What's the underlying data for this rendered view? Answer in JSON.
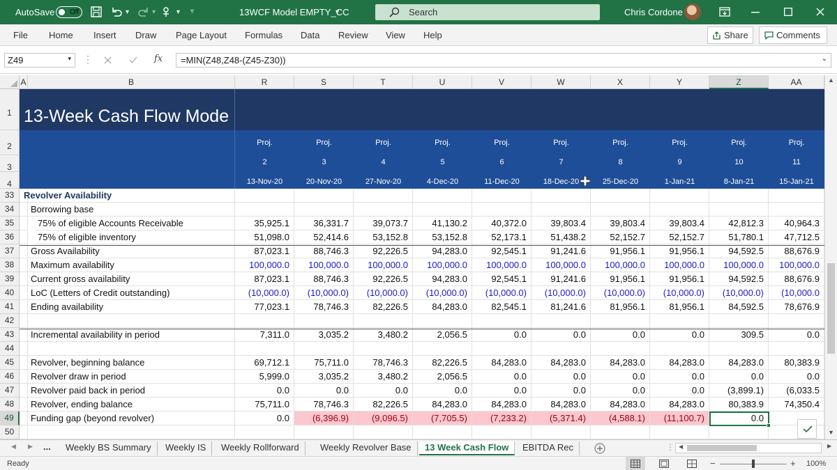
{
  "titlebar": {
    "autosave_label": "AutoSave",
    "autosave_state": "Off",
    "filename": "13WCF Model EMPTY_CC",
    "search_placeholder": "Search",
    "user_name": "Chris Cordone"
  },
  "menu": {
    "items": [
      "File",
      "Home",
      "Insert",
      "Draw",
      "Page Layout",
      "Formulas",
      "Data",
      "Review",
      "View",
      "Help"
    ],
    "share": "Share",
    "comments": "Comments"
  },
  "formula_bar": {
    "name_box": "Z49",
    "fx": "fx",
    "formula": "=MIN(Z48,Z48-(Z45-Z30))"
  },
  "columns": {
    "letters": [
      "A",
      "B",
      "R",
      "S",
      "T",
      "U",
      "V",
      "W",
      "X",
      "Y",
      "Z",
      "AA"
    ]
  },
  "sheet": {
    "title": "13-Week Cash Flow Mode",
    "proj_label": "Proj.",
    "weeks": [
      "2",
      "3",
      "4",
      "5",
      "6",
      "7",
      "8",
      "9",
      "10",
      "11"
    ],
    "dates": [
      "13-Nov-20",
      "20-Nov-20",
      "27-Nov-20",
      "4-Dec-20",
      "11-Dec-20",
      "18-Dec-20",
      "25-Dec-20",
      "1-Jan-21",
      "8-Jan-21",
      "15-Jan-21"
    ],
    "row_numbers": [
      "1",
      "2",
      "3",
      "4",
      "33",
      "34",
      "35",
      "36",
      "37",
      "38",
      "39",
      "40",
      "41",
      "42",
      "43",
      "44",
      "45",
      "46",
      "47",
      "48",
      "49",
      "50"
    ],
    "rows": [
      {
        "num": "33",
        "label": "Revolver Availability",
        "values": []
      },
      {
        "num": "34",
        "label": "Borrowing base",
        "values": []
      },
      {
        "num": "35",
        "label": "75% of eligible Accounts Receivable",
        "values": [
          "35,925.1",
          "36,331.7",
          "39,073.7",
          "41,130.2",
          "40,372.0",
          "39,803.4",
          "39,803.4",
          "39,803.4",
          "42,812.3",
          "40,964.3"
        ]
      },
      {
        "num": "36",
        "label": "75% of eligible inventory",
        "values": [
          "51,098.0",
          "52,414.6",
          "53,152.8",
          "53,152.8",
          "52,173.1",
          "51,438.2",
          "52,152.7",
          "52,152.7",
          "51,780.1",
          "47,712.5"
        ]
      },
      {
        "num": "37",
        "label": "Gross Availability",
        "values": [
          "87,023.1",
          "88,746.3",
          "92,226.5",
          "94,283.0",
          "92,545.1",
          "91,241.6",
          "91,956.1",
          "91,956.1",
          "94,592.5",
          "88,676.9"
        ]
      },
      {
        "num": "38",
        "label": "Maximum availability",
        "values": [
          "100,000.0",
          "100,000.0",
          "100,000.0",
          "100,000.0",
          "100,000.0",
          "100,000.0",
          "100,000.0",
          "100,000.0",
          "100,000.0",
          "100,000.0"
        ]
      },
      {
        "num": "39",
        "label": "Current gross availability",
        "values": [
          "87,023.1",
          "88,746.3",
          "92,226.5",
          "94,283.0",
          "92,545.1",
          "91,241.6",
          "91,956.1",
          "91,956.1",
          "94,592.5",
          "88,676.9"
        ]
      },
      {
        "num": "40",
        "label": "LoC (Letters of Credit outstanding)",
        "values": [
          "(10,000.0)",
          "(10,000.0)",
          "(10,000.0)",
          "(10,000.0)",
          "(10,000.0)",
          "(10,000.0)",
          "(10,000.0)",
          "(10,000.0)",
          "(10,000.0)",
          "(10,000.0"
        ]
      },
      {
        "num": "41",
        "label": "Ending availability",
        "values": [
          "77,023.1",
          "78,746.3",
          "82,226.5",
          "84,283.0",
          "82,545.1",
          "81,241.6",
          "81,956.1",
          "81,956.1",
          "84,592.5",
          "78,676.9"
        ]
      },
      {
        "num": "42",
        "label": "",
        "values": []
      },
      {
        "num": "43",
        "label": "Incremental availability in period",
        "values": [
          "7,311.0",
          "3,035.2",
          "3,480.2",
          "2,056.5",
          "0.0",
          "0.0",
          "0.0",
          "0.0",
          "309.5",
          "0.0"
        ]
      },
      {
        "num": "44",
        "label": "",
        "values": []
      },
      {
        "num": "45",
        "label": "Revolver, beginning balance",
        "values": [
          "69,712.1",
          "75,711.0",
          "78,746.3",
          "82,226.5",
          "84,283.0",
          "84,283.0",
          "84,283.0",
          "84,283.0",
          "84,283.0",
          "80,383.9"
        ]
      },
      {
        "num": "46",
        "label": "Revolver draw in period",
        "values": [
          "5,999.0",
          "3,035.2",
          "3,480.2",
          "2,056.5",
          "0.0",
          "0.0",
          "0.0",
          "0.0",
          "0.0",
          "0.0"
        ]
      },
      {
        "num": "47",
        "label": "Revolver paid back in period",
        "values": [
          "0.0",
          "0.0",
          "0.0",
          "0.0",
          "0.0",
          "0.0",
          "0.0",
          "0.0",
          "(3,899.1)",
          "(6,033.5"
        ]
      },
      {
        "num": "48",
        "label": "Revolver, ending balance",
        "values": [
          "75,711.0",
          "78,746.3",
          "82,226.5",
          "84,283.0",
          "84,283.0",
          "84,283.0",
          "84,283.0",
          "84,283.0",
          "80,383.9",
          "74,350.4"
        ]
      },
      {
        "num": "49",
        "label": "Funding gap (beyond revolver)",
        "values": [
          "0.0",
          "(6,396.9)",
          "(9,096.5)",
          "(7,705.5)",
          "(7,233.2)",
          "(5,371.4)",
          "(4,588.1)",
          "(11,100.7)",
          "0.0",
          ""
        ]
      },
      {
        "num": "50",
        "label": "",
        "values": []
      }
    ]
  },
  "tabs": {
    "ellipsis": "...",
    "items": [
      "Weekly BS Summary",
      "Weekly IS",
      "Weekly Rollforward",
      "Weekly Revolver Base",
      "13 Week Cash Flow",
      "EBITDA Rec"
    ],
    "active_index": 4
  },
  "status": {
    "ready": "Ready",
    "zoom": "100%"
  },
  "colors": {
    "excel_green": "#217346",
    "header_dark": "#1f3864",
    "header_blue": "#1f4e99",
    "negative_fill": "#fcc7cf"
  }
}
